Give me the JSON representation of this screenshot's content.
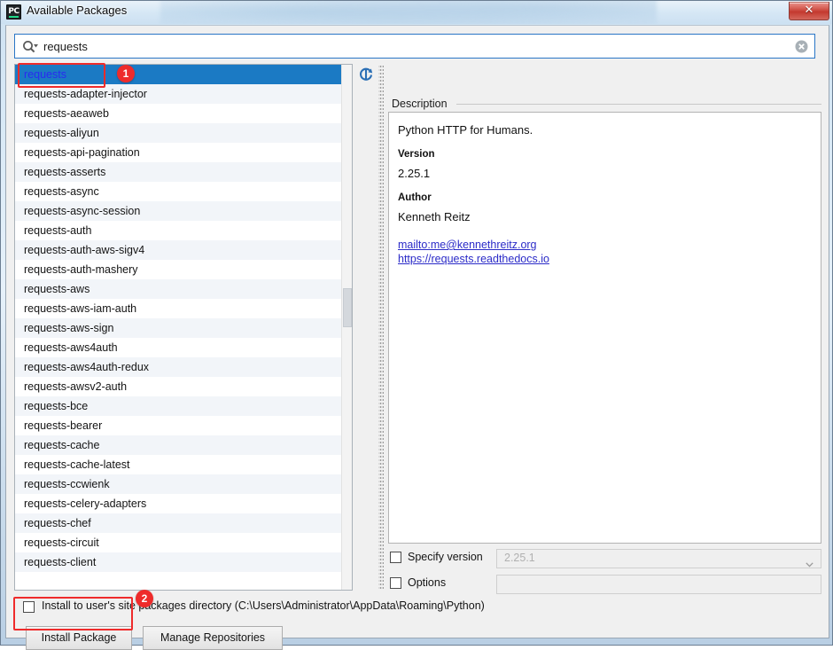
{
  "window": {
    "title": "Available Packages",
    "app_icon": "pycharm-icon",
    "app_icon_text": "PC",
    "close_label": "✕"
  },
  "search": {
    "value": "requests",
    "placeholder": "",
    "icon": "search-icon",
    "clear_icon": "clear-icon"
  },
  "list": {
    "refresh_icon": "refresh-icon",
    "selected_index": 0,
    "items": [
      "requests",
      "requests-adapter-injector",
      "requests-aeaweb",
      "requests-aliyun",
      "requests-api-pagination",
      "requests-asserts",
      "requests-async",
      "requests-async-session",
      "requests-auth",
      "requests-auth-aws-sigv4",
      "requests-auth-mashery",
      "requests-aws",
      "requests-aws-iam-auth",
      "requests-aws-sign",
      "requests-aws4auth",
      "requests-aws4auth-redux",
      "requests-awsv2-auth",
      "requests-bce",
      "requests-bearer",
      "requests-cache",
      "requests-cache-latest",
      "requests-ccwienk",
      "requests-celery-adapters",
      "requests-chef",
      "requests-circuit",
      "requests-client"
    ]
  },
  "description": {
    "group_label": "Description",
    "summary": "Python HTTP for Humans.",
    "version_label": "Version",
    "version_value": "2.25.1",
    "author_label": "Author",
    "author_value": "Kenneth Reitz",
    "links": [
      "mailto:me@kennethreitz.org",
      "https://requests.readthedocs.io"
    ]
  },
  "options": {
    "specify_version_label": "Specify version",
    "specify_version_value": "2.25.1",
    "specify_version_checked": false,
    "options_label": "Options",
    "options_value": "",
    "options_checked": false,
    "install_user_label": "Install to user's site packages directory (C:\\Users\\Administrator\\AppData\\Roaming\\Python)",
    "install_user_checked": false
  },
  "buttons": {
    "install_package": "Install Package",
    "manage_repositories": "Manage Repositories"
  },
  "annotations": {
    "badge_1": "1",
    "badge_2": "2",
    "color": "#ee2b2b"
  },
  "colors": {
    "selection_bg": "#1b7ac4",
    "selection_fg": "#2a2af0",
    "link": "#2b2bc8",
    "accent_border": "#2a76c6"
  }
}
